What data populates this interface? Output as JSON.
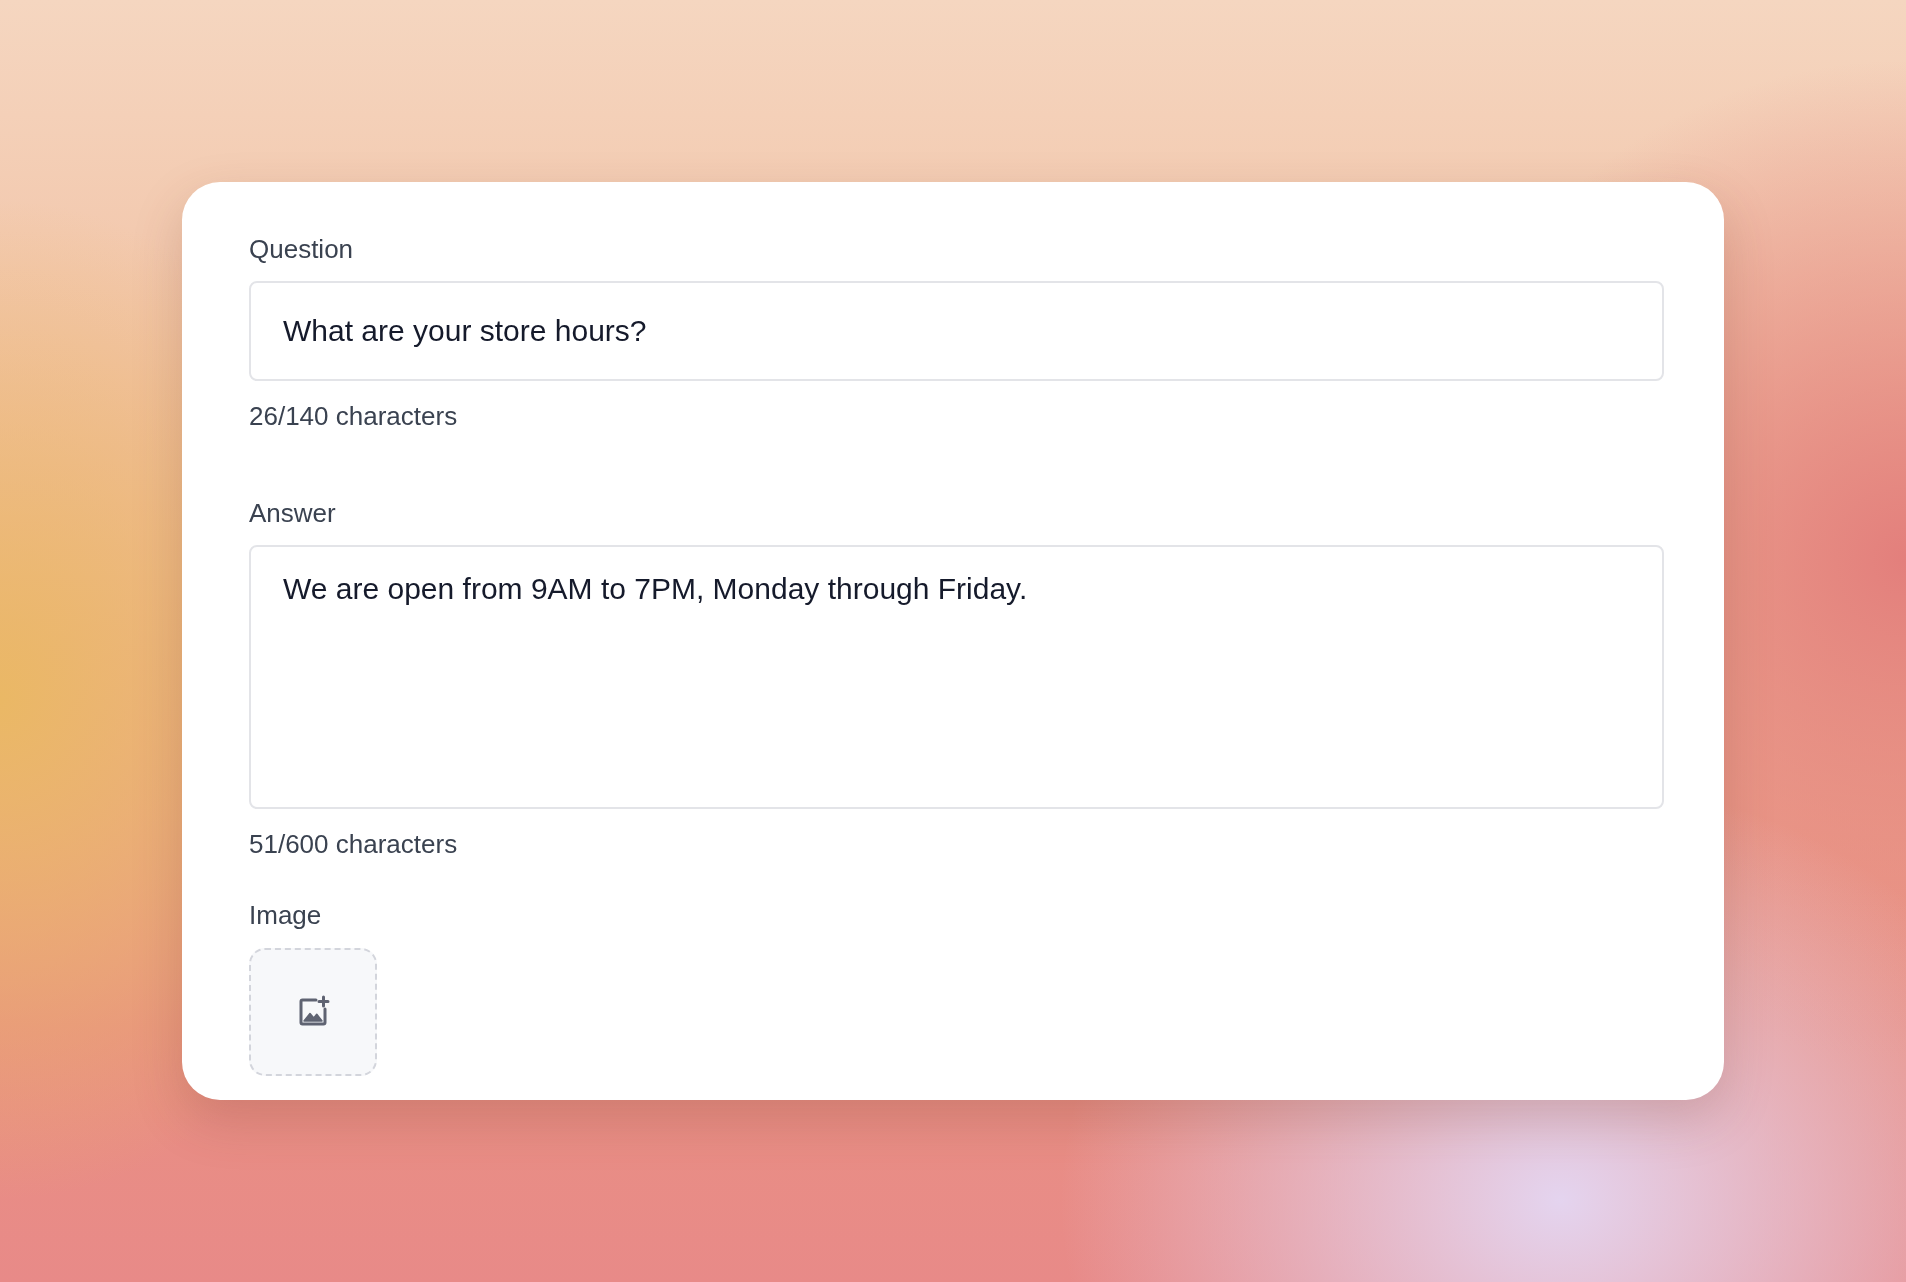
{
  "fields": [
    {
      "kind": "text",
      "label": "Question",
      "value": "What are your store hours?",
      "counter": "26/140 characters"
    },
    {
      "kind": "textarea",
      "label": "Answer",
      "value": "We are open from 9AM to 7PM, Monday through Friday.",
      "counter": "51/600 characters"
    }
  ],
  "image_field": {
    "label": "Image"
  }
}
